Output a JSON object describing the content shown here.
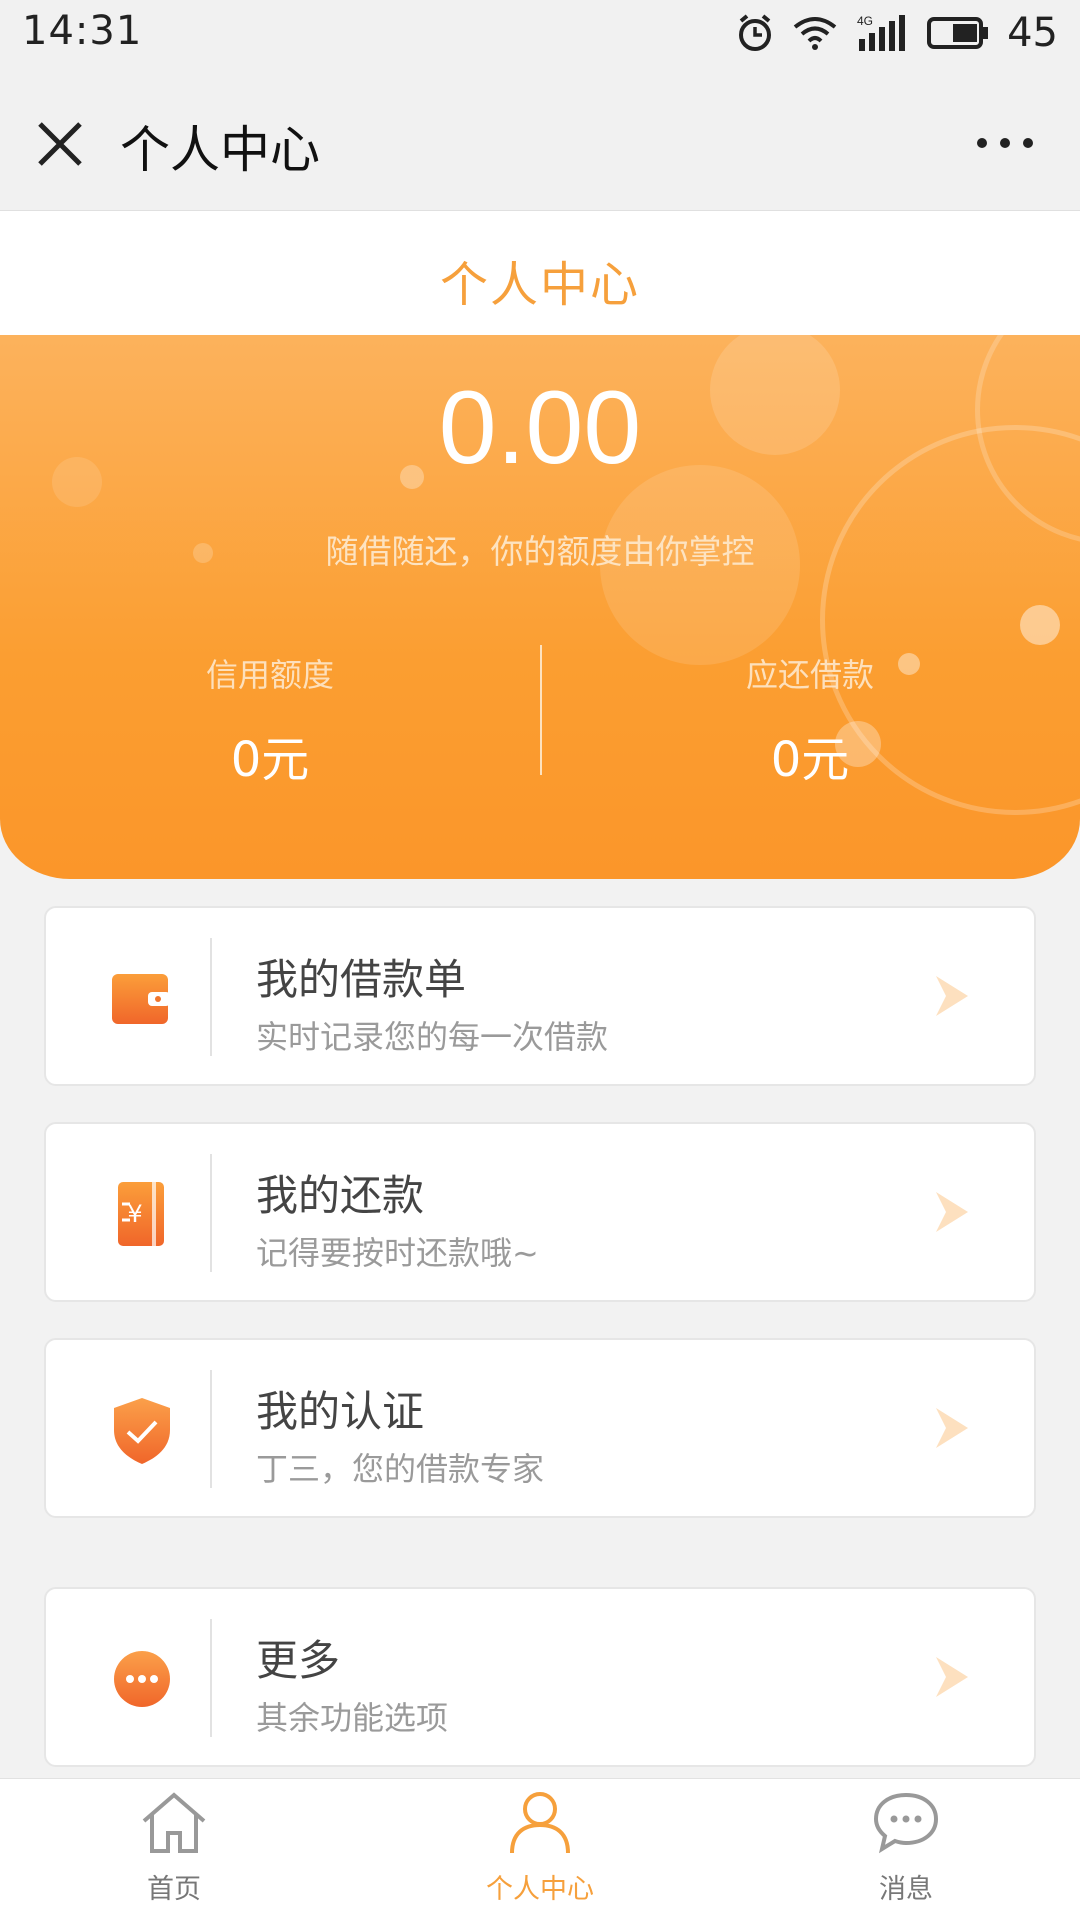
{
  "status": {
    "time": "14:31",
    "battery": "45",
    "network": "4G"
  },
  "nav": {
    "title": "个人中心"
  },
  "page": {
    "title": "个人中心"
  },
  "hero": {
    "amount": "0.00",
    "slogan": "随借随还，你的额度由你掌控",
    "credit_label": "信用额度",
    "credit_value": "0元",
    "due_label": "应还借款",
    "due_value": "0元"
  },
  "menu": [
    {
      "title": "我的借款单",
      "subtitle": "实时记录您的每一次借款",
      "icon": "wallet-icon"
    },
    {
      "title": "我的还款",
      "subtitle": "记得要按时还款哦~",
      "icon": "repay-book-icon"
    },
    {
      "title": "我的认证",
      "subtitle": "丁三，您的借款专家",
      "icon": "shield-check-icon"
    },
    {
      "title": "更多",
      "subtitle": "其余功能选项",
      "icon": "more-dots-icon"
    }
  ],
  "tabs": [
    {
      "label": "首页",
      "icon": "home-icon",
      "active": false
    },
    {
      "label": "个人中心",
      "icon": "user-icon",
      "active": true
    },
    {
      "label": "消息",
      "icon": "message-icon",
      "active": false
    }
  ],
  "colors": {
    "accent": "#f6a03c",
    "hero_top": "#fcb25c",
    "hero_bottom": "#fb962a"
  }
}
